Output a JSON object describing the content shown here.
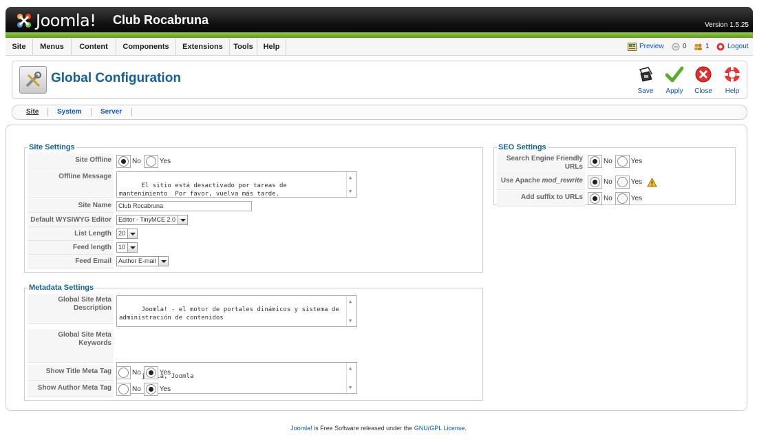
{
  "header": {
    "logo_text": "Joomla!",
    "site_name": "Club Rocabruna",
    "version": "Version 1.5.25"
  },
  "menu": {
    "items": [
      "Site",
      "Menus",
      "Content",
      "Components",
      "Extensions",
      "Tools",
      "Help"
    ],
    "preview": "Preview",
    "messages_count": "0",
    "users_count": "1",
    "logout": "Logout"
  },
  "toolbar": {
    "title": "Global Configuration",
    "save": "Save",
    "apply": "Apply",
    "close": "Close",
    "help": "Help"
  },
  "tabs": [
    "Site",
    "System",
    "Server"
  ],
  "site_settings": {
    "legend": "Site Settings",
    "site_offline": {
      "label": "Site Offline",
      "no": "No",
      "yes": "Yes",
      "selected": "No"
    },
    "offline_message": {
      "label": "Offline Message",
      "value": "El sitio está desactivado por tareas de\nmantenimiento  Por favor, vuelva más tarde."
    },
    "site_name": {
      "label": "Site Name",
      "value": "Club Rocabruna"
    },
    "editor": {
      "label": "Default WYSIWYG Editor",
      "value": "Editor - TinyMCE 2.0"
    },
    "list_length": {
      "label": "List Length",
      "value": "20"
    },
    "feed_length": {
      "label": "Feed length",
      "value": "10"
    },
    "feed_email": {
      "label": "Feed Email",
      "value": "Author E-mail"
    }
  },
  "metadata_settings": {
    "legend": "Metadata Settings",
    "meta_description": {
      "label": "Global Site Meta Description",
      "value": "Joomla! - el motor de portales dinámicos y sistema de\nadministración de contenidos"
    },
    "meta_keywords": {
      "label": "Global Site Meta Keywords",
      "value": "joomla, Joomla"
    },
    "show_title": {
      "label": "Show Title Meta Tag",
      "no": "No",
      "yes": "Yes",
      "selected": "Yes"
    },
    "show_author": {
      "label": "Show Author Meta Tag",
      "no": "No",
      "yes": "Yes",
      "selected": "Yes"
    }
  },
  "seo_settings": {
    "legend": "SEO Settings",
    "sef_urls": {
      "label": "Search Engine Friendly URLs",
      "no": "No",
      "yes": "Yes",
      "selected": "No"
    },
    "mod_rewrite": {
      "label_prefix": "Use Apache ",
      "label_em": "mod_rewrite",
      "no": "No",
      "yes": "Yes",
      "selected": "No"
    },
    "suffix": {
      "label": "Add suffix to URLs",
      "no": "No",
      "yes": "Yes",
      "selected": "No"
    }
  },
  "footer": {
    "link1": "Joomla!",
    "text": " is Free Software released under the ",
    "link2": "GNU/GPL License",
    "end": "."
  },
  "colors": {
    "brand_blue": "#146295",
    "link_blue": "#0b55c4",
    "green_bar": "#7bc12f"
  }
}
